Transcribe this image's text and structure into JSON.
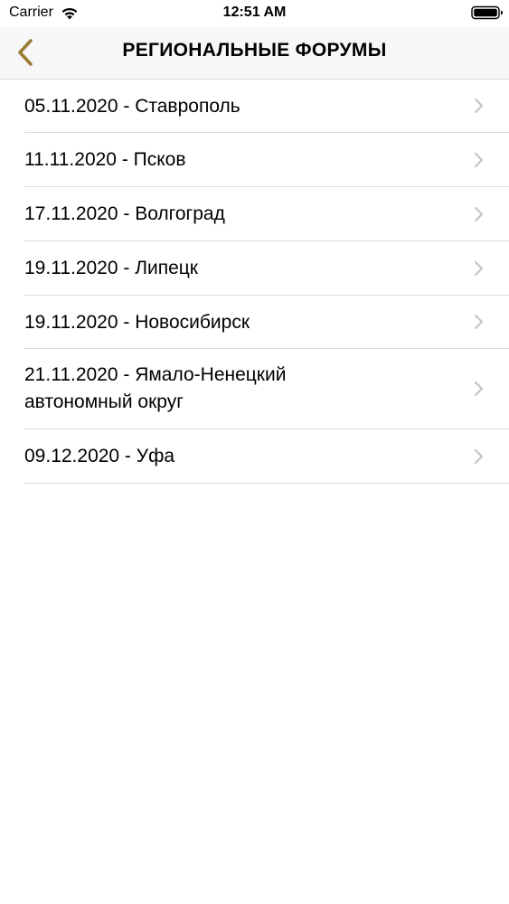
{
  "status_bar": {
    "carrier": "Carrier",
    "time": "12:51 AM"
  },
  "nav": {
    "title": "РЕГИОНАЛЬНЫЕ ФОРУМЫ",
    "accent_color": "#9a7a35"
  },
  "forums": [
    {
      "label": "05.11.2020 - Ставрополь"
    },
    {
      "label": "11.11.2020 - Псков"
    },
    {
      "label": "17.11.2020 - Волгоград"
    },
    {
      "label": "19.11.2020 - Липецк"
    },
    {
      "label": "19.11.2020 - Новосибирск"
    },
    {
      "label": "21.11.2020 - Ямало-Ненецкий автономный округ"
    },
    {
      "label": "09.12.2020 - Уфа"
    }
  ]
}
